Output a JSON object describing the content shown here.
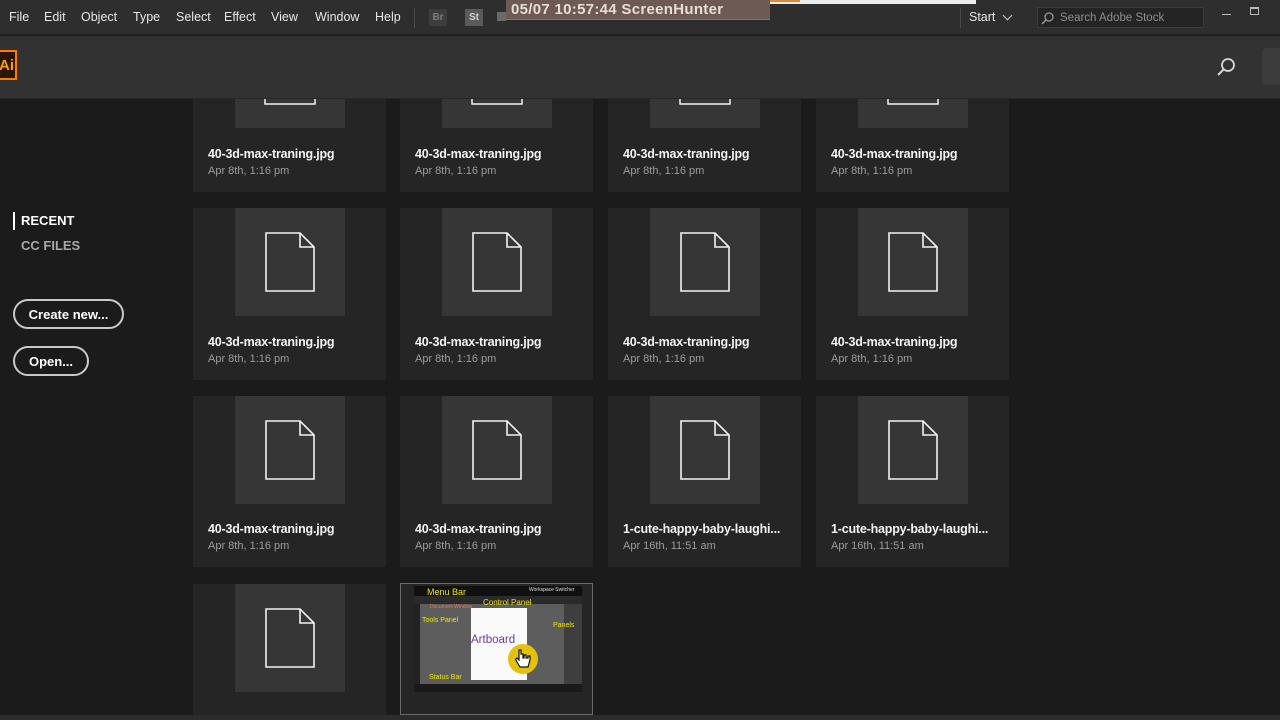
{
  "menubar": {
    "items": [
      "File",
      "Edit",
      "Object",
      "Type",
      "Select",
      "Effect",
      "View",
      "Window",
      "Help"
    ],
    "badge_br": "Br",
    "badge_st": "St",
    "overlay_text": "05/07  10:57:44  ScreenHunter",
    "workspace": "Start",
    "stock_placeholder": "Search Adobe Stock"
  },
  "header": {
    "logo": "Ai"
  },
  "sidebar": {
    "recent": "RECENT",
    "cc_files": "CC FILES",
    "create_new": "Create new...",
    "open": "Open..."
  },
  "files": [
    {
      "name": "40-3d-max-traning.jpg",
      "date": "Apr 8th, 1:16 pm"
    },
    {
      "name": "40-3d-max-traning.jpg",
      "date": "Apr 8th, 1:16 pm"
    },
    {
      "name": "40-3d-max-traning.jpg",
      "date": "Apr 8th, 1:16 pm"
    },
    {
      "name": "40-3d-max-traning.jpg",
      "date": "Apr 8th, 1:16 pm"
    },
    {
      "name": "40-3d-max-traning.jpg",
      "date": "Apr 8th, 1:16 pm"
    },
    {
      "name": "40-3d-max-traning.jpg",
      "date": "Apr 8th, 1:16 pm"
    },
    {
      "name": "40-3d-max-traning.jpg",
      "date": "Apr 8th, 1:16 pm"
    },
    {
      "name": "40-3d-max-traning.jpg",
      "date": "Apr 8th, 1:16 pm"
    },
    {
      "name": "40-3d-max-traning.jpg",
      "date": "Apr 8th, 1:16 pm"
    },
    {
      "name": "40-3d-max-traning.jpg",
      "date": "Apr 8th, 1:16 pm"
    },
    {
      "name": "1-cute-happy-baby-laughi...",
      "date": "Apr 16th, 11:51 am"
    },
    {
      "name": "1-cute-happy-baby-laughi...",
      "date": "Apr 16th, 11:51 am"
    }
  ],
  "artboard_thumb": {
    "menu_bar": "Menu Bar",
    "workspace_switcher": "Workspace Switcher",
    "control_panel": "Control Panel",
    "document_window": "Document Window",
    "tools_panel": "Tools Panel",
    "artboard": "Artboard",
    "panels": "Panels",
    "status_bar": "Status Bar"
  },
  "colors": {
    "accent": "#ff7c00",
    "background": "#1b1b1b",
    "card": "#252525"
  }
}
